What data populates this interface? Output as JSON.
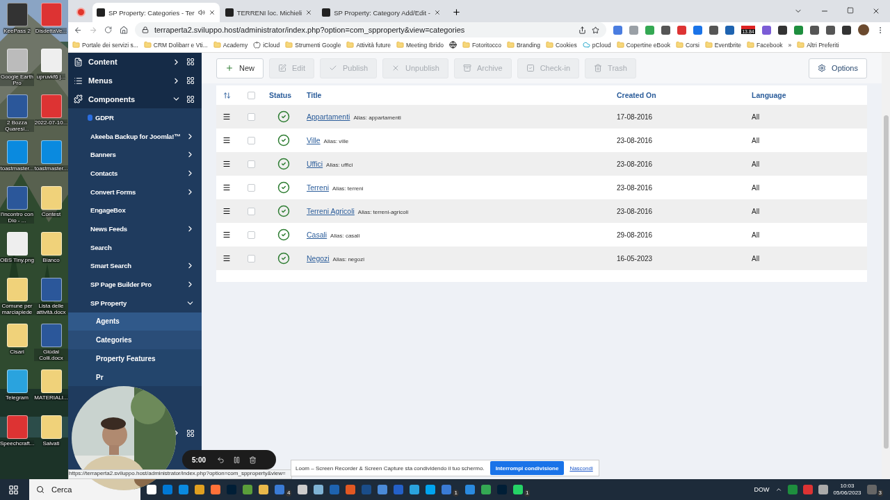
{
  "desktop": {
    "icons": [
      {
        "label": "KeePass 2"
      },
      {
        "label": "DisdettaVe..."
      },
      {
        "label": "Google Earth Pro"
      },
      {
        "label": "upruvkf6 j..."
      },
      {
        "label": "2 Bozza Quaresi..."
      },
      {
        "label": "2022-07-10..."
      },
      {
        "label": "toastmaster..."
      },
      {
        "label": "toastmaster..."
      },
      {
        "label": "l'incontro con Dio - ..."
      },
      {
        "label": "Contest"
      },
      {
        "label": "OBS Tiny.png"
      },
      {
        "label": "Bianco"
      },
      {
        "label": "Comune per marciapiede"
      },
      {
        "label": "Lista delle attività.docx"
      },
      {
        "label": "Cisari"
      },
      {
        "label": "Giùdai Colli.docx"
      },
      {
        "label": "Telegram"
      },
      {
        "label": "MATERIALI..."
      },
      {
        "label": "Speechcraft..."
      },
      {
        "label": "Salvati"
      }
    ]
  },
  "browser": {
    "tabs": [
      {
        "title": "SP Property: Categories - Ter",
        "selected": true
      },
      {
        "title": "TERRENI loc. Michieli",
        "selected": false
      },
      {
        "title": "SP Property: Category Add/Edit -",
        "selected": false
      }
    ],
    "address": "terraperta2.sviluppo.host/administrator/index.php?option=com_spproperty&view=categories",
    "extension_badge": "13.84",
    "bookmarks": [
      {
        "label": "Portale dei servizi s..."
      },
      {
        "label": "CRM Dolibarr e Vti..."
      },
      {
        "label": "Academy"
      },
      {
        "label": "iCloud"
      },
      {
        "label": "Strumenti Google"
      },
      {
        "label": "Attività future"
      },
      {
        "label": "Meeting Ibrido"
      },
      {
        "label": "Fotoritocco"
      },
      {
        "label": "Branding"
      },
      {
        "label": "Cookies"
      },
      {
        "label": "pCloud"
      },
      {
        "label": "Copertine eBook"
      },
      {
        "label": "Corsi"
      },
      {
        "label": "Eventbrite"
      },
      {
        "label": "Facebook"
      }
    ],
    "bookmarks_more": "»",
    "other_bookmarks": "Altri Preferiti"
  },
  "sidebar": {
    "items": [
      {
        "label": "Content",
        "expanded": false
      },
      {
        "label": "Menus",
        "expanded": false
      },
      {
        "label": "Components",
        "expanded": true,
        "children": [
          {
            "label": "GDPR",
            "submenu": false
          },
          {
            "label": "Akeeba Backup for Joomla!™",
            "submenu": true
          },
          {
            "label": "Banners",
            "submenu": true
          },
          {
            "label": "Contacts",
            "submenu": true
          },
          {
            "label": "Convert Forms",
            "submenu": true
          },
          {
            "label": "EngageBox",
            "submenu": false
          },
          {
            "label": "News Feeds",
            "submenu": true
          },
          {
            "label": "Search",
            "submenu": false
          },
          {
            "label": "Smart Search",
            "submenu": true
          },
          {
            "label": "SP Page Builder Pro",
            "submenu": true
          },
          {
            "label": "SP Property",
            "submenu": true,
            "expanded": true,
            "children": [
              {
                "label": "Agents",
                "selected": false,
                "hovered": true
              },
              {
                "label": "Categories",
                "selected": true,
                "hovered": false
              },
              {
                "label": "Property Features",
                "selected": false,
                "hovered": false
              },
              {
                "label": "Pr",
                "selected": false,
                "hovered": false
              }
            ]
          }
        ]
      },
      {
        "expanded": false
      }
    ]
  },
  "toolbar": {
    "buttons": [
      {
        "label": "New",
        "disabled": false
      },
      {
        "label": "Edit",
        "disabled": true
      },
      {
        "label": "Publish",
        "disabled": true
      },
      {
        "label": "Unpublish",
        "disabled": true
      },
      {
        "label": "Archive",
        "disabled": true
      },
      {
        "label": "Check-in",
        "disabled": true
      },
      {
        "label": "Trash",
        "disabled": true
      }
    ],
    "options": "Options"
  },
  "table": {
    "columns": [
      "Status",
      "Title",
      "Created On",
      "Language"
    ],
    "all_checked": false,
    "rows": [
      {
        "title": "Appartamenti",
        "alias": "Alias: appartamenti",
        "created": "17-08-2016",
        "language": "All",
        "published": true,
        "checked": false
      },
      {
        "title": "Ville",
        "alias": "Alias: ville",
        "created": "23-08-2016",
        "language": "All",
        "published": true,
        "checked": false
      },
      {
        "title": "Uffici",
        "alias": "Alias: uffici",
        "created": "23-08-2016",
        "language": "All",
        "published": true,
        "checked": false
      },
      {
        "title": "Terreni",
        "alias": "Alias: terreni",
        "created": "23-08-2016",
        "language": "All",
        "published": true,
        "checked": false
      },
      {
        "title": "Terreni Agricoli",
        "alias": "Alias: terreni-agricoli",
        "created": "23-08-2016",
        "language": "All",
        "published": true,
        "checked": false
      },
      {
        "title": "Casali",
        "alias": "Alias: casali",
        "created": "29-08-2016",
        "language": "All",
        "published": true,
        "checked": false
      },
      {
        "title": "Negozi",
        "alias": "Alias: negozi",
        "created": "16-05-2023",
        "language": "All",
        "published": true,
        "checked": false
      }
    ]
  },
  "status_url": "https://terraperta2.sviluppo.host/administrator/index.php?option=com_spproperty&view=",
  "recorder": {
    "time": "5:00"
  },
  "loom_banner": {
    "message": "Loom – Screen Recorder & Screen Capture sta condividendo il tuo schermo.",
    "stop_button": "Interrompi condivisione",
    "hide_link": "Nascondi"
  },
  "taskbar": {
    "search": "Cerca",
    "badges": [
      "4",
      "1",
      "1"
    ],
    "ticker": "DOW",
    "time": "10:03",
    "date": "05/06/2023",
    "notifications": "3"
  }
}
